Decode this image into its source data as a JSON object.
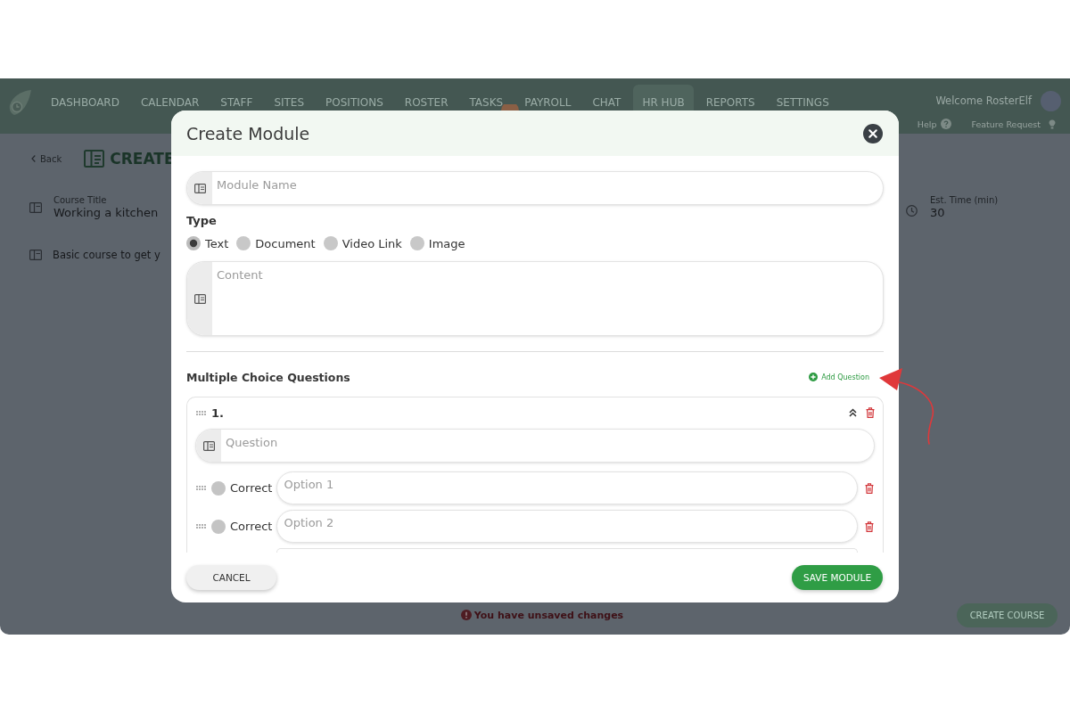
{
  "app": {
    "nav": {
      "items": [
        {
          "label": "DASHBOARD",
          "selected": false,
          "badge": false
        },
        {
          "label": "CALENDAR",
          "selected": false,
          "badge": false
        },
        {
          "label": "STAFF",
          "selected": false,
          "badge": false
        },
        {
          "label": "SITES",
          "selected": false,
          "badge": false
        },
        {
          "label": "POSITIONS",
          "selected": false,
          "badge": false
        },
        {
          "label": "ROSTER",
          "selected": false,
          "badge": false
        },
        {
          "label": "TASKS",
          "selected": false,
          "badge": true
        },
        {
          "label": "PAYROLL",
          "selected": false,
          "badge": false
        },
        {
          "label": "CHAT",
          "selected": false,
          "badge": false
        },
        {
          "label": "HR HUB",
          "selected": true,
          "badge": false
        },
        {
          "label": "REPORTS",
          "selected": false,
          "badge": false
        },
        {
          "label": "SETTINGS",
          "selected": false,
          "badge": false
        }
      ],
      "welcome": "Welcome RosterElf",
      "help": "Help",
      "feature_request": "Feature Request"
    },
    "back": "Back",
    "page_title": "CREATE",
    "course_title": {
      "label": "Course Title",
      "value": "Working a kitchen"
    },
    "description": {
      "value": "Basic course to get y"
    },
    "est_time": {
      "label": "Est. Time (min)",
      "value": "30"
    },
    "unsaved_message": "You have unsaved changes",
    "create_course_button": "CREATE COURSE"
  },
  "modal": {
    "title": "Create Module",
    "module_name": {
      "placeholder": "Module Name"
    },
    "type": {
      "label": "Type",
      "options": [
        {
          "label": "Text",
          "selected": true
        },
        {
          "label": "Document",
          "selected": false
        },
        {
          "label": "Video Link",
          "selected": false
        },
        {
          "label": "Image",
          "selected": false
        }
      ]
    },
    "content": {
      "placeholder": "Content"
    },
    "questions_heading": "Multiple Choice Questions",
    "add_question": "Add Question",
    "questions": [
      {
        "number": "1.",
        "expanded": true,
        "question": {
          "placeholder": "Question"
        },
        "options": [
          {
            "label": "Correct",
            "placeholder": "Option 1",
            "selected": false
          },
          {
            "label": "Correct",
            "placeholder": "Option 2",
            "selected": false
          }
        ],
        "more_options_below": true
      }
    ],
    "cancel_button": "CANCEL",
    "save_button": "SAVE MODULE"
  }
}
